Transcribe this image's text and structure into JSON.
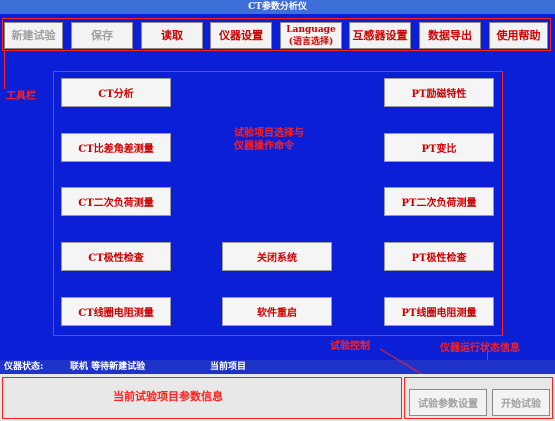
{
  "window": {
    "title": "CT参数分析仪"
  },
  "toolbar": {
    "buttons": [
      {
        "label": "新建试验",
        "state": "disabled"
      },
      {
        "label": "保存",
        "state": "disabled"
      },
      {
        "label": "读取",
        "state": "enabled"
      },
      {
        "label": "仪器设置",
        "state": "enabled"
      },
      {
        "label_line1": "Language",
        "label_line2": "(语言选择)",
        "state": "enabled"
      },
      {
        "label": "互感器设置",
        "state": "enabled"
      },
      {
        "label": "数据导出",
        "state": "enabled"
      },
      {
        "label": "使用帮助",
        "state": "enabled"
      }
    ]
  },
  "annotations": {
    "toolbar": "工具栏",
    "main_line1": "试验项目选择与",
    "main_line2": "仪器操作命令",
    "test_control": "试验控制",
    "status_info": "仪器运行状态信息",
    "current_info": "当前试验项目参数信息"
  },
  "commands": {
    "ct_analysis": "CT分析",
    "ct_ratio_angle": "CT比差角差测量",
    "ct_secondary_load": "CT二次负荷测量",
    "ct_polarity": "CT极性检查",
    "ct_coil_resistance": "CT线圈电阻测量",
    "shutdown": "关闭系统",
    "restart": "软件重启",
    "pt_excitation": "PT励磁特性",
    "pt_ratio": "PT变比",
    "pt_secondary_load": "PT二次负荷测量",
    "pt_polarity": "PT极性检查",
    "pt_coil_resistance": "PT线圈电阻测量"
  },
  "status": {
    "label": "仪器状态:",
    "value": "联机 等待新建试验",
    "current_item_label": "当前项目"
  },
  "controls": {
    "test_params": "试验参数设置",
    "start_test": "开始试验"
  },
  "colors": {
    "background": "#0b1fd6",
    "annotation": "#ff2020",
    "button_text": "#cc0000",
    "disabled_text": "#a0a0a0"
  }
}
